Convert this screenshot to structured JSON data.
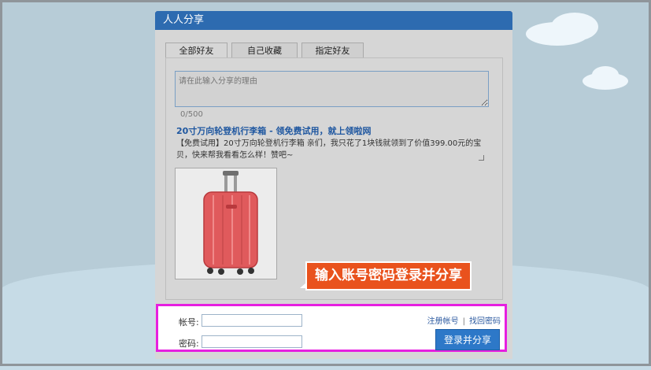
{
  "dialog": {
    "title": "人人分享"
  },
  "tabs": [
    "全部好友",
    "自己收藏",
    "指定好友"
  ],
  "share": {
    "reason_placeholder": "请在此输入分享的理由",
    "counter": "0/500"
  },
  "article": {
    "title": "20寸万向轮登机行李箱 - 领免费试用，就上领啦网",
    "description": "【免费试用】20寸万向轮登机行李箱 亲们，我只花了1块钱就领到了价值399.00元的宝贝，快来帮我看看怎么样！赞吧~"
  },
  "tooltip": "输入账号密码登录并分享",
  "login": {
    "account_label": "帐号:",
    "password_label": "密码:",
    "register_link": "注册帐号",
    "separator": "|",
    "recover_link": "找回密码",
    "submit_label": "登录并分享"
  },
  "colors": {
    "header": "#2d6bb0",
    "highlight_border": "#e61fe0",
    "tooltip": "#e9521d",
    "luggage": "#e05a5c"
  }
}
